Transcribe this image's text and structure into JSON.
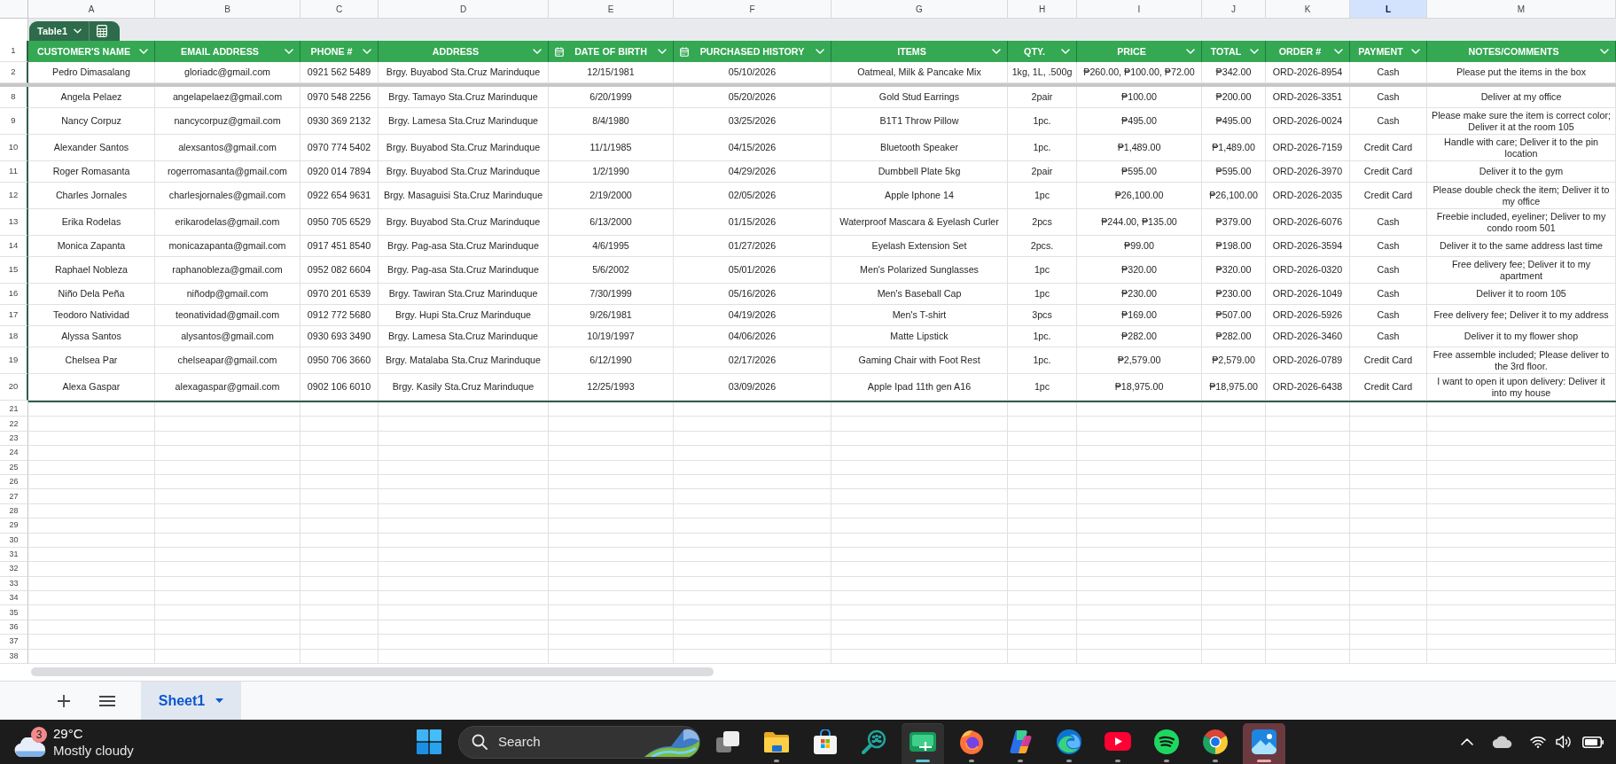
{
  "column_letters": [
    {
      "label": "A",
      "selected": false
    },
    {
      "label": "B",
      "selected": false
    },
    {
      "label": "C",
      "selected": false
    },
    {
      "label": "D",
      "selected": false
    },
    {
      "label": "E",
      "selected": false
    },
    {
      "label": "F",
      "selected": false
    },
    {
      "label": "G",
      "selected": false
    },
    {
      "label": "H",
      "selected": false
    },
    {
      "label": "I",
      "selected": false
    },
    {
      "label": "J",
      "selected": false
    },
    {
      "label": "K",
      "selected": false
    },
    {
      "label": "L",
      "selected": true
    },
    {
      "label": "M",
      "selected": false
    }
  ],
  "table": {
    "name": "Table1",
    "header_row_number": "1",
    "columns": [
      {
        "label": "CUSTOMER'S NAME",
        "kind": "text"
      },
      {
        "label": "EMAIL ADDRESS",
        "kind": "text"
      },
      {
        "label": "PHONE #",
        "kind": "text"
      },
      {
        "label": "ADDRESS",
        "kind": "text"
      },
      {
        "label": "DATE OF BIRTH",
        "kind": "date"
      },
      {
        "label": "PURCHASED HISTORY",
        "kind": "date"
      },
      {
        "label": "ITEMS",
        "kind": "text"
      },
      {
        "label": "QTY.",
        "kind": "text"
      },
      {
        "label": "PRICE",
        "kind": "text"
      },
      {
        "label": "TOTAL",
        "kind": "text"
      },
      {
        "label": "ORDER #",
        "kind": "text"
      },
      {
        "label": "PAYMENT",
        "kind": "text"
      },
      {
        "label": "NOTES/COMMENTS",
        "kind": "text"
      }
    ],
    "rows": [
      {
        "row_number": "2",
        "frozen": true,
        "cells": [
          "Pedro Dimasalang",
          "gloriadc@gmail.com",
          "0921 562 5489",
          "Brgy. Buyabod Sta.Cruz Marinduque",
          "12/15/1981",
          "05/10/2026",
          "Oatmeal, Milk & Pancake Mix",
          "1kg, 1L, .500g",
          "₱260.00, ₱100.00, ₱72.00",
          "₱342.00",
          "ORD-2026-8954",
          "Cash",
          "Please put the items in the box"
        ]
      },
      {
        "row_number": "8",
        "frozen": false,
        "cells": [
          "Angela Pelaez",
          "angelapelaez@gmail.com",
          "0970 548 2256",
          "Brgy. Tamayo Sta.Cruz Marinduque",
          "6/20/1999",
          "05/20/2026",
          "Gold Stud Earrings",
          "2pair",
          "₱100.00",
          "₱200.00",
          "ORD-2026-3351",
          "Cash",
          "Deliver at my office"
        ]
      },
      {
        "row_number": "9",
        "frozen": false,
        "cells": [
          "Nancy Corpuz",
          "nancycorpuz@gmail.com",
          "0930 369 2132",
          "Brgy. Lamesa Sta.Cruz Marinduque",
          "8/4/1980",
          "03/25/2026",
          "B1T1 Throw Pillow",
          "1pc.",
          "₱495.00",
          "₱495.00",
          "ORD-2026-0024",
          "Cash",
          "Please make sure the item is correct color; Deliver it at the room 105"
        ]
      },
      {
        "row_number": "10",
        "frozen": false,
        "cells": [
          "Alexander Santos",
          "alexsantos@gmail.com",
          "0970 774 5402",
          "Brgy. Buyabod Sta.Cruz Marinduque",
          "11/1/1985",
          "04/15/2026",
          "Bluetooth Speaker",
          "1pc.",
          "₱1,489.00",
          "₱1,489.00",
          "ORD-2026-7159",
          "Credit Card",
          "Handle with care; Deliver it to the pin location"
        ]
      },
      {
        "row_number": "11",
        "frozen": false,
        "cells": [
          "Roger Romasanta",
          "rogerromasanta@gmail.com",
          "0920 014 7894",
          "Brgy. Buyabod Sta.Cruz Marinduque",
          "1/2/1990",
          "04/29/2026",
          "Dumbbell Plate 5kg",
          "2pair",
          "₱595.00",
          "₱595.00",
          "ORD-2026-3970",
          "Credit Card",
          "Deliver it to the gym"
        ]
      },
      {
        "row_number": "12",
        "frozen": false,
        "cells": [
          "Charles Jornales",
          "charlesjornales@gmail.com",
          "0922 654 9631",
          "Brgy. Masaguisi Sta.Cruz Marinduque",
          "2/19/2000",
          "02/05/2026",
          "Apple Iphone 14",
          "1pc",
          "₱26,100.00",
          "₱26,100.00",
          "ORD-2026-2035",
          "Credit Card",
          "Please double check the item; Deliver it to my office"
        ]
      },
      {
        "row_number": "13",
        "frozen": false,
        "cells": [
          "Erika Rodelas",
          "erikarodelas@gmail.com",
          "0950 705 6529",
          "Brgy. Buyabod Sta.Cruz Marinduque",
          "6/13/2000",
          "01/15/2026",
          "Waterproof Mascara & Eyelash Curler",
          "2pcs",
          "₱244.00, ₱135.00",
          "₱379.00",
          "ORD-2026-6076",
          "Cash",
          "Freebie included, eyeliner; Deliver to my condo room 501"
        ]
      },
      {
        "row_number": "14",
        "frozen": false,
        "cells": [
          "Monica Zapanta",
          "monicazapanta@gmail.com",
          "0917 451 8540",
          "Brgy. Pag-asa Sta.Cruz Marinduque",
          "4/6/1995",
          "01/27/2026",
          "Eyelash Extension Set",
          "2pcs.",
          "₱99.00",
          "₱198.00",
          "ORD-2026-3594",
          "Cash",
          "Deliver it to the same address last time"
        ]
      },
      {
        "row_number": "15",
        "frozen": false,
        "cells": [
          "Raphael Nobleza",
          "raphanobleza@gmail.com",
          "0952 082 6604",
          "Brgy. Pag-asa Sta.Cruz Marinduque",
          "5/6/2002",
          "05/01/2026",
          "Men's Polarized Sunglasses",
          "1pc",
          "₱320.00",
          "₱320.00",
          "ORD-2026-0320",
          "Cash",
          "Free delivery fee; Deliver it to my apartment"
        ]
      },
      {
        "row_number": "16",
        "frozen": false,
        "cells": [
          "Niño Dela Peña",
          "niñodp@gmail.com",
          "0970 201 6539",
          "Brgy. Tawiran Sta.Cruz Marinduque",
          "7/30/1999",
          "05/16/2026",
          "Men's Baseball Cap",
          "1pc",
          "₱230.00",
          "₱230.00",
          "ORD-2026-1049",
          "Cash",
          "Deliver it to room 105"
        ]
      },
      {
        "row_number": "17",
        "frozen": false,
        "cells": [
          "Teodoro Natividad",
          "teonatividad@gmail.com",
          "0912 772 5680",
          "Brgy. Hupi Sta.Cruz Marinduque",
          "9/26/1981",
          "04/19/2026",
          "Men's T-shirt",
          "3pcs",
          "₱169.00",
          "₱507.00",
          "ORD-2026-5926",
          "Cash",
          "Free delivery fee; Deliver it to my address"
        ]
      },
      {
        "row_number": "18",
        "frozen": false,
        "cells": [
          "Alyssa Santos",
          "alysantos@gmail.com",
          "0930 693 3490",
          "Brgy. Lamesa Sta.Cruz Marinduque",
          "10/19/1997",
          "04/06/2026",
          "Matte Lipstick",
          "1pc.",
          "₱282.00",
          "₱282.00",
          "ORD-2026-3460",
          "Cash",
          "Deliver it to my flower shop"
        ]
      },
      {
        "row_number": "19",
        "frozen": false,
        "cells": [
          "Chelsea Par",
          "chelseapar@gmail.com",
          "0950 706 3660",
          "Brgy. Matalaba Sta.Cruz Marinduque",
          "6/12/1990",
          "02/17/2026",
          "Gaming Chair with Foot Rest",
          "1pc.",
          "₱2,579.00",
          "₱2,579.00",
          "ORD-2026-0789",
          "Credit Card",
          "Free assemble included; Please deliver to the 3rd floor."
        ]
      },
      {
        "row_number": "20",
        "frozen": false,
        "cells": [
          "Alexa Gaspar",
          "alexagaspar@gmail.com",
          "0902 106 6010",
          "Brgy. Kasily Sta.Cruz Marinduque",
          "12/25/1993",
          "03/09/2026",
          "Apple Ipad 11th gen A16",
          "1pc",
          "₱18,975.00",
          "₱18,975.00",
          "ORD-2026-6438",
          "Credit Card",
          "I want to open it upon delivery: Deliver it into my house"
        ]
      }
    ]
  },
  "empty_rows": [
    "21",
    "22",
    "23",
    "24",
    "25",
    "26",
    "27",
    "28",
    "29",
    "30",
    "31",
    "32",
    "33",
    "34",
    "35",
    "36",
    "37",
    "38"
  ],
  "sheet_tabs": [
    {
      "label": "Sheet1",
      "selected": true
    }
  ],
  "taskbar": {
    "weather": {
      "badge": "3",
      "temperature": "29°C",
      "condition": "Mostly cloudy"
    },
    "search": {
      "label": "Search"
    },
    "apps": [
      {
        "kind": "task_view",
        "running": false,
        "active": false,
        "flashing": false
      },
      {
        "kind": "files",
        "running": true,
        "active": false,
        "flashing": false
      },
      {
        "kind": "store",
        "running": false,
        "active": false,
        "flashing": false
      },
      {
        "kind": "people_search",
        "running": false,
        "active": false,
        "flashing": false
      },
      {
        "kind": "sheet",
        "running": true,
        "active": true,
        "flashing": false
      },
      {
        "kind": "fox",
        "running": true,
        "active": false,
        "flashing": false
      },
      {
        "kind": "swirl",
        "running": true,
        "active": false,
        "flashing": false
      },
      {
        "kind": "wave",
        "running": true,
        "active": false,
        "flashing": false
      },
      {
        "kind": "video",
        "running": true,
        "active": false,
        "flashing": false
      },
      {
        "kind": "music",
        "running": true,
        "active": false,
        "flashing": false
      },
      {
        "kind": "globe",
        "running": true,
        "active": false,
        "flashing": false
      },
      {
        "kind": "photos",
        "running": true,
        "active": false,
        "flashing": true
      }
    ]
  }
}
